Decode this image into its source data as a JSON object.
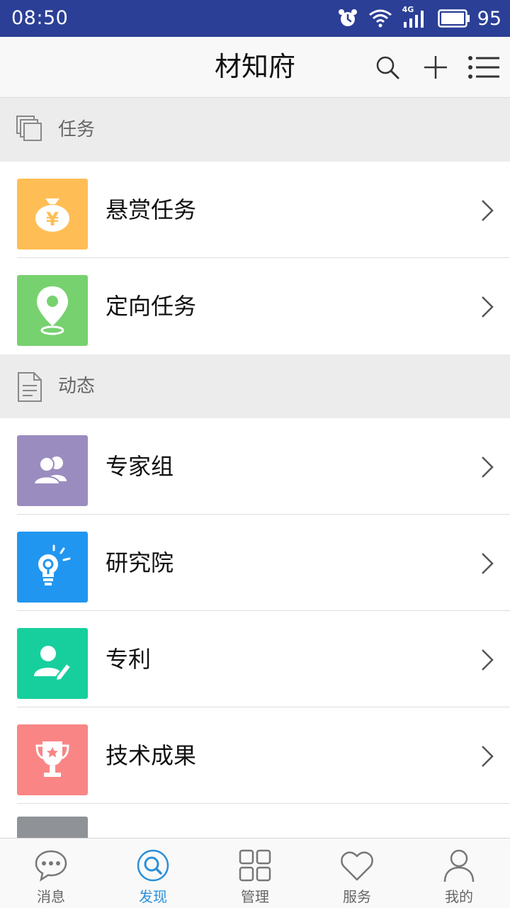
{
  "status_bar": {
    "time": "08:50",
    "network": "4G",
    "battery": "95"
  },
  "app_bar": {
    "title": "材知府",
    "icons": [
      "search-icon",
      "plus-icon",
      "menu-icon"
    ]
  },
  "sections": [
    {
      "title": "任务",
      "icon": "layers-icon",
      "items": [
        {
          "label": "悬赏任务",
          "icon": "money-bag-icon",
          "color": "#ffbe55"
        },
        {
          "label": "定向任务",
          "icon": "location-pin-icon",
          "color": "#77d16f"
        }
      ]
    },
    {
      "title": "动态",
      "icon": "document-icon",
      "items": [
        {
          "label": "专家组",
          "icon": "group-icon",
          "color": "#9b8cc0"
        },
        {
          "label": "研究院",
          "icon": "lightbulb-icon",
          "color": "#2196f0"
        },
        {
          "label": "专利",
          "icon": "user-edit-icon",
          "color": "#17cf9d"
        },
        {
          "label": "技术成果",
          "icon": "trophy-icon",
          "color": "#fa8585"
        }
      ]
    }
  ],
  "tab_bar": {
    "active": "发现",
    "tabs": [
      {
        "label": "消息",
        "icon": "chat-bubble-icon"
      },
      {
        "label": "发现",
        "icon": "search-circle-icon"
      },
      {
        "label": "管理",
        "icon": "grid-icon"
      },
      {
        "label": "服务",
        "icon": "heart-icon"
      },
      {
        "label": "我的",
        "icon": "person-icon"
      }
    ]
  },
  "colors": {
    "status_bar": "#2b3f96",
    "accent": "#2a8fd8"
  }
}
